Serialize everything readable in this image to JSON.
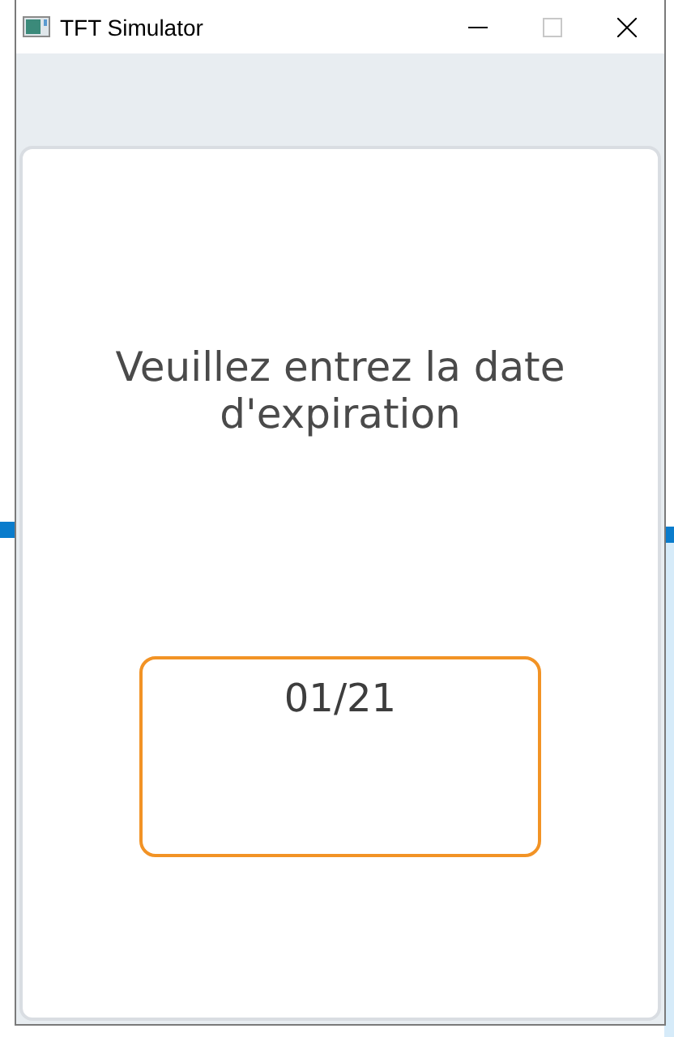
{
  "window": {
    "title": "TFT Simulator"
  },
  "dialog": {
    "prompt": "Veuillez entrez la date d'expiration"
  },
  "date_field": {
    "value": "01/21"
  }
}
